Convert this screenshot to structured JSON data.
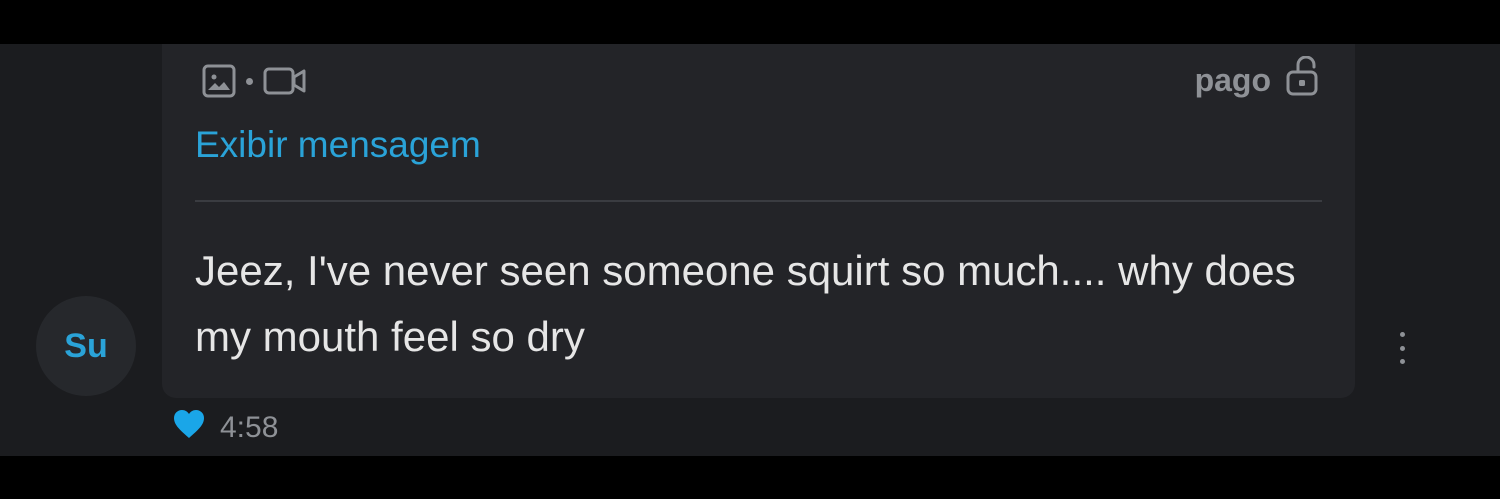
{
  "message": {
    "media_icons": [
      "image-icon",
      "video-icon"
    ],
    "status_label": "pago",
    "status_icon": "unlock-icon",
    "view_link": "Exibir mensagem",
    "text": "Jeez, I've never seen someone squirt so much.... why does my mouth feel so dry",
    "sender_initials": "Su",
    "time": "4:58",
    "liked": true,
    "like_color": "#1aa6e8"
  },
  "colors": {
    "accent": "#2aa3d8",
    "bubble": "#232428",
    "background": "#1b1c1f"
  }
}
